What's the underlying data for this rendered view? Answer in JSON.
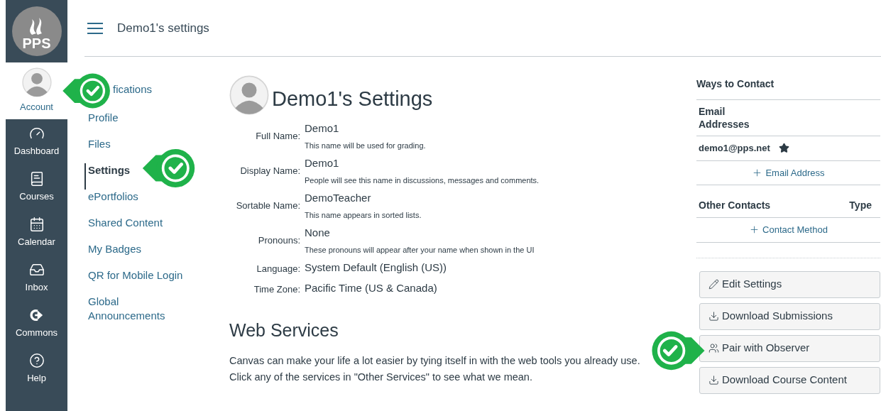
{
  "logo": {
    "text": "PPS"
  },
  "global_nav": [
    {
      "label": "Account",
      "selected": true
    },
    {
      "label": "Dashboard",
      "selected": false
    },
    {
      "label": "Courses",
      "selected": false
    },
    {
      "label": "Calendar",
      "selected": false
    },
    {
      "label": "Inbox",
      "selected": false
    },
    {
      "label": "Commons",
      "selected": false
    },
    {
      "label": "Help",
      "selected": false
    }
  ],
  "header": {
    "title": "Demo1's settings"
  },
  "account_nav": [
    {
      "label": "fications",
      "selected": false
    },
    {
      "label": "Profile",
      "selected": false
    },
    {
      "label": "Files",
      "selected": false
    },
    {
      "label": "Settings",
      "selected": true
    },
    {
      "label": "ePortfolios",
      "selected": false
    },
    {
      "label": "Shared Content",
      "selected": false
    },
    {
      "label": "My Badges",
      "selected": false
    },
    {
      "label": "QR for Mobile Login",
      "selected": false
    },
    {
      "label": "Global Announcements",
      "selected": false
    }
  ],
  "profile": {
    "heading": "Demo1's Settings",
    "fields": [
      {
        "label": "Full Name:",
        "value": "Demo1",
        "hint": "This name will be used for grading."
      },
      {
        "label": "Display Name:",
        "value": "Demo1",
        "hint": "People will see this name in discussions, messages and comments."
      },
      {
        "label": "Sortable Name:",
        "value": "DemoTeacher",
        "hint": "This name appears in sorted lists."
      },
      {
        "label": "Pronouns:",
        "value": "None",
        "hint": "These pronouns will appear after your name when shown in the UI"
      },
      {
        "label": "Language:",
        "value": "System Default (English (US))"
      },
      {
        "label": "Time Zone:",
        "value": "Pacific Time (US & Canada)"
      }
    ]
  },
  "web_services": {
    "heading": "Web Services",
    "text": "Canvas can make your life a lot easier by tying itself in with the web tools you already use. Click any of the services in \"Other Services\" to see what we mean."
  },
  "contact": {
    "title": "Ways to Contact",
    "email_heading": "Email Addresses",
    "emails": [
      {
        "address": "demo1@pps.net",
        "default": true
      }
    ],
    "add_email": "Email Address",
    "other_heading": "Other Contacts",
    "type_heading": "Type",
    "add_contact": "Contact Method"
  },
  "actions": [
    {
      "label": "Edit Settings",
      "kind": "edit"
    },
    {
      "label": "Download Submissions",
      "kind": "download"
    },
    {
      "label": "Pair with Observer",
      "kind": "pair"
    },
    {
      "label": "Download Course Content",
      "kind": "download"
    }
  ]
}
